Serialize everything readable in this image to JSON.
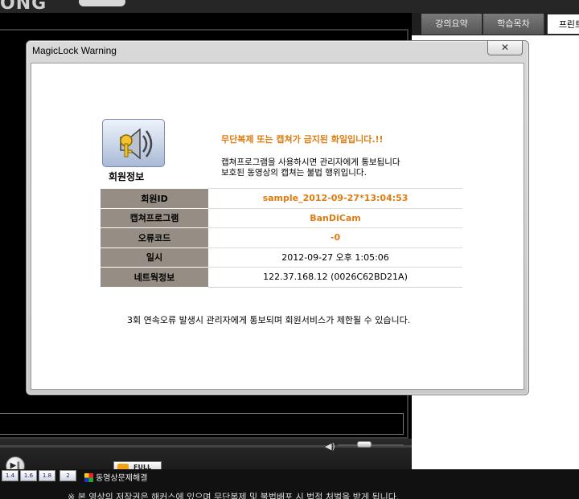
{
  "background_app": {
    "top_title": "",
    "tabs": [
      "강의요약",
      "학습목차",
      "프린트"
    ],
    "speed_buttons": [
      "1.4",
      "1.6",
      "1.8",
      "2"
    ],
    "full_label": "FULL",
    "help_link": "동영상문제해결",
    "notice": "※ 본 영상의 저작권은 해커스에 있으며 무단복제 및 불법배포 시 법적 처벌을 받게 됩니다."
  },
  "dialog": {
    "title": "MagicLock Warning",
    "close_glyph": "✕",
    "member_info_label": "회원정보",
    "warning_title": "무단복제 또는 캡쳐가 금지된 화일입니다.!!",
    "warning_lines": [
      "캡쳐프로그램을 사용하시면 관리자에게 통보됩니다",
      "보호된 동영상의 캡쳐는 불법 행위입니다."
    ],
    "table": [
      {
        "label": "회원ID",
        "value": "sample_2012-09-27*13:04:53",
        "highlight": true
      },
      {
        "label": "캡쳐프로그램",
        "value": "BanDiCam",
        "highlight": true
      },
      {
        "label": "오류코드",
        "value": "-0",
        "highlight": true
      },
      {
        "label": "일시",
        "value": "2012-09-27 오후 1:05:06",
        "highlight": false
      },
      {
        "label": "네트웍정보",
        "value": "122.37.168.12 (0026C62BD21A)",
        "highlight": false
      }
    ],
    "footer_note": "3회 연속오류 발생시 관리자에게 통보되며 회원서비스가 제한될 수 있습니다."
  },
  "colors": {
    "accent_orange": "#e07b10",
    "table_header": "#968e84"
  }
}
